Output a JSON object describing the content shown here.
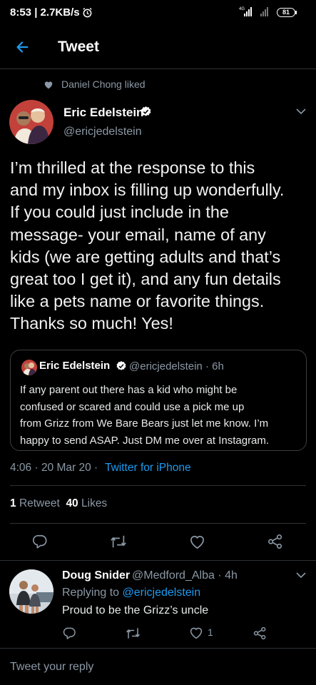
{
  "status_bar": {
    "time_speed": "8:53 | 2.7KB/s",
    "network": "4G",
    "battery": "81"
  },
  "header": {
    "title": "Tweet"
  },
  "social_context": {
    "text": "Daniel Chong liked"
  },
  "tweet": {
    "author_name": "Eric Edelstein",
    "author_handle": "@ericjedelstein",
    "body": "I’m thrilled at the response to this\nand my inbox is filling up wonderfully.\nIf you could just include in the\nmessage- your email, name of any\nkids (we are getting adults and that’s\ngreat too I get it), and any fun details\nlike a pets name or favorite things.\nThanks so much! Yes!",
    "timestamp": "4:06 · 20 Mar 20 ·",
    "source": "Twitter for iPhone",
    "retweet_count": "1",
    "retweet_label": "Retweet",
    "like_count": "40",
    "like_label": "Likes"
  },
  "quote": {
    "author_name": "Eric Edelstein",
    "handle_time": "@ericjedelstein · 6h",
    "text": "If any parent out there has a kid who might be\nconfused or scared and could use a pick me up\nfrom Grizz from We Bare Bears just let me know. I’m\nhappy to send ASAP. Just DM me over at Instagram."
  },
  "reply": {
    "author_name": "Doug Snider",
    "handle_time": "@Medford_Alba · 4h",
    "replying_label": "Replying to",
    "replying_handle": "@ericjedelstein",
    "text": "Proud to be the Grizz’s uncle",
    "like_count": "1"
  },
  "composer": {
    "placeholder": "Tweet your reply"
  },
  "colors": {
    "background": "#000000",
    "accent": "#1d9bf0",
    "secondary_text": "#8b98a5",
    "divider": "#2f3336"
  }
}
